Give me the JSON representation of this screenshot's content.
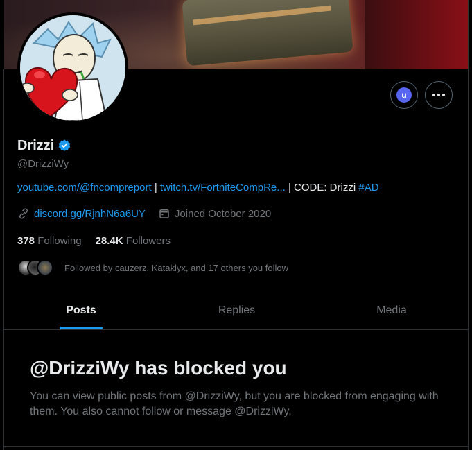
{
  "profile": {
    "display_name": "Drizzi",
    "handle": "@DrizziWy",
    "bio": {
      "link1": "youtube.com/@fncompreport",
      "sep1": " | ",
      "link2": "twitch.tv/FortniteCompRe...",
      "sep2": " | CODE: Drizzi ",
      "hashtag": "#AD"
    },
    "website": "discord.gg/RjnhN6a6UY",
    "joined": "Joined October 2020",
    "following_count": "378",
    "following_label": "Following",
    "followers_count": "28.4K",
    "followers_label": "Followers",
    "followed_by": "Followed by cauzerz, Kataklyx, and 17 others you follow"
  },
  "actions": {
    "user_badge": "u",
    "more_icon": "more-horizontal-icon"
  },
  "tabs": [
    {
      "label": "Posts",
      "active": true
    },
    {
      "label": "Replies",
      "active": false
    },
    {
      "label": "Media",
      "active": false
    }
  ],
  "blocked": {
    "title": "@DrizziWy has blocked you",
    "description": "You can view public posts from @DrizziWy, but you are blocked from engaging with them. You also cannot follow or message @DrizziWy."
  },
  "colors": {
    "background": "#000000",
    "accent": "#1d9bf0",
    "text_primary": "#e7e9ea",
    "text_secondary": "#71767b",
    "border": "#2f3336",
    "badge": "#5865f2"
  }
}
